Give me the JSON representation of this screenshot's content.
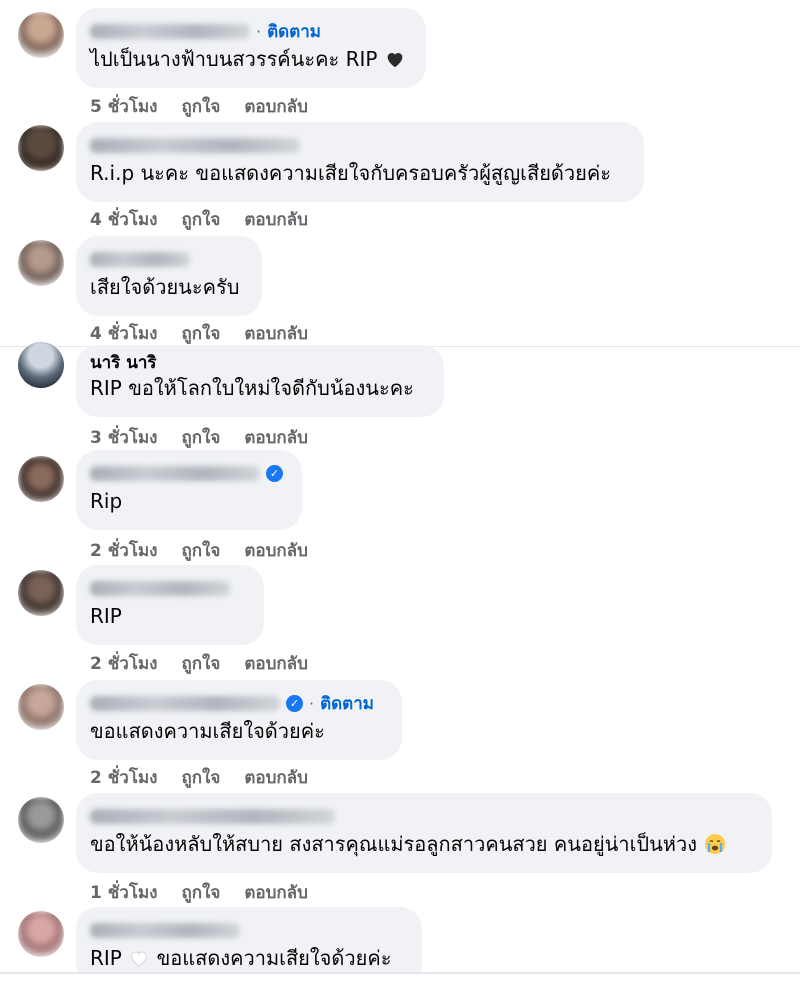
{
  "comments": [
    {
      "author": "",
      "follow": "ติดตาม",
      "text": "ไปเป็นนางฟ้าบนสวรรค์นะคะ RIP",
      "time": "5 ชั่วโมง",
      "like": "ถูกใจ",
      "reply": "ตอบกลับ",
      "emoji": "black-heart-icon"
    },
    {
      "author": "",
      "text": "R.i.p นะคะ ขอแสดงความเสียใจกับครอบครัวผู้สูญเสียด้วยค่ะ",
      "time": "4 ชั่วโมง",
      "like": "ถูกใจ",
      "reply": "ตอบกลับ"
    },
    {
      "author": "",
      "text": "เสียใจด้วยนะครับ",
      "time": "4 ชั่วโมง",
      "like": "ถูกใจ",
      "reply": "ตอบกลับ"
    },
    {
      "author": "นาริ นาริ",
      "text": "RIP ขอให้โลกใบใหม่ใจดีกับน้องนะคะ",
      "time": "3 ชั่วโมง",
      "like": "ถูกใจ",
      "reply": "ตอบกลับ"
    },
    {
      "author": "",
      "verified": true,
      "text": "Rip",
      "time": "2 ชั่วโมง",
      "like": "ถูกใจ",
      "reply": "ตอบกลับ"
    },
    {
      "author": "",
      "text": "RIP",
      "time": "2 ชั่วโมง",
      "like": "ถูกใจ",
      "reply": "ตอบกลับ"
    },
    {
      "author": "",
      "verified": true,
      "follow": "ติดตาม",
      "text": "ขอแสดงความเสียใจด้วยค่ะ",
      "time": "2 ชั่วโมง",
      "like": "ถูกใจ",
      "reply": "ตอบกลับ"
    },
    {
      "author": "",
      "text": "ขอให้น้องหลับให้สบาย สงสารคุณแม่รอลูกสาวคนสวย คนอยู่น่าเป็นห่วง",
      "time": "1 ชั่วโมง",
      "like": "ถูกใจ",
      "reply": "ตอบกลับ",
      "emoji": "crying-face-icon"
    },
    {
      "author": "",
      "text_prefix": "RIP",
      "text": "ขอแสดงความเสียใจด้วยค่ะ",
      "emoji": "white-heart-icon"
    }
  ],
  "colors": {
    "bubble": "#f0f2f5",
    "meta": "#65676b",
    "follow": "#0064d1",
    "verified": "#1877f2"
  }
}
